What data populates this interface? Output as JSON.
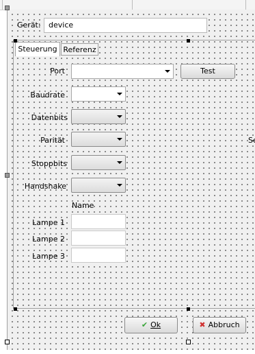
{
  "device": {
    "label": "Gerät:",
    "value": "device"
  },
  "tabs": [
    {
      "label": "Steuerung",
      "active": true
    },
    {
      "label": "Referenz",
      "active": false
    }
  ],
  "steuerung": {
    "port_label": "Port",
    "test_button": "Test",
    "baudrate_label": "Baudrate",
    "datenbits_label": "Datenbits",
    "paritaet_label": "Parität",
    "stoppbits_label": "Stoppbits",
    "handshake_label": "Handshake",
    "right_cut_label": "Se",
    "name_header": "Name",
    "lampen": [
      "Lampe 1",
      "Lampe 2",
      "Lampe 3"
    ]
  },
  "buttons": {
    "ok": "Ok",
    "abbruch": "Abbruch"
  },
  "colors": {
    "ok_icon": "#3aa53a",
    "cancel_icon": "#d03030"
  },
  "icons": {
    "ok": "checkmark-icon",
    "abbruch": "x-icon"
  }
}
